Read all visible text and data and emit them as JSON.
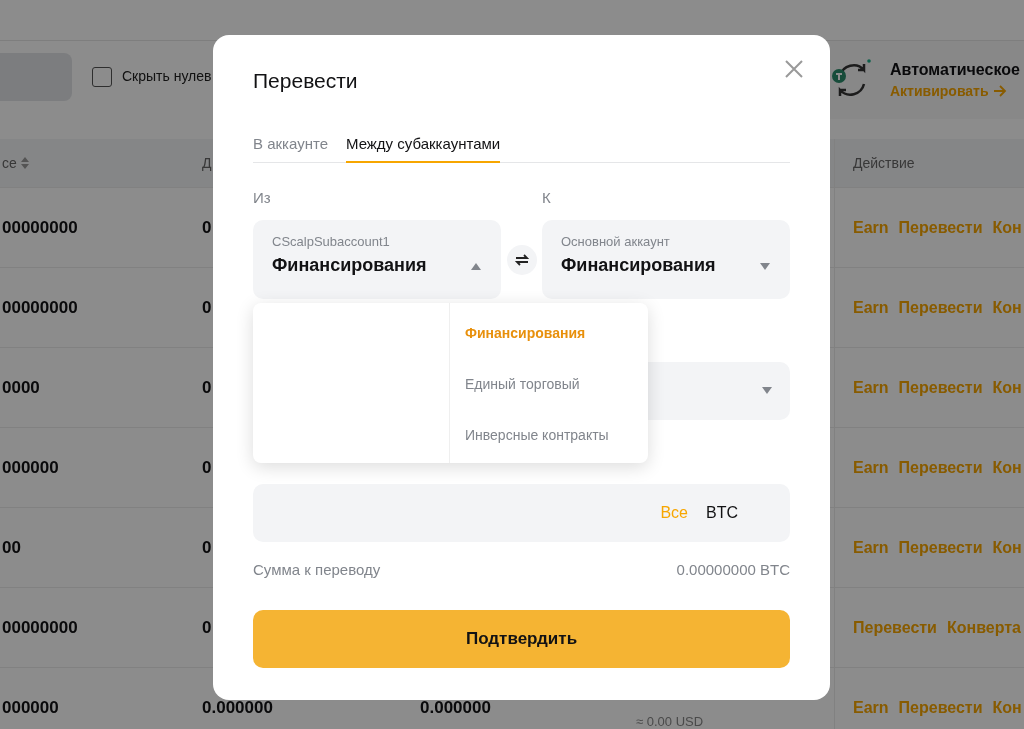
{
  "toolbar": {
    "hide_zero": {
      "label": "Скрыть нулев",
      "checked": false
    }
  },
  "banner": {
    "title": "Автоматическое",
    "link": "Активировать"
  },
  "table": {
    "header": {
      "column_1": "се",
      "column_2": "Д",
      "action": "Действие"
    },
    "rows": [
      {
        "column_1": "00000000",
        "column_2": "0",
        "actions": [
          "Earn",
          "Перевести",
          "Кон"
        ]
      },
      {
        "column_1": "00000000",
        "column_2": "0",
        "actions": [
          "Earn",
          "Перевести",
          "Кон"
        ]
      },
      {
        "column_1": "0000",
        "column_2": "0",
        "actions": [
          "Earn",
          "Перевести",
          "Кон"
        ]
      },
      {
        "column_1": "000000",
        "column_2": "0",
        "actions": [
          "Earn",
          "Перевести",
          "Кон"
        ]
      },
      {
        "column_1": "00",
        "column_2": "0",
        "actions": [
          "Earn",
          "Перевести",
          "Кон"
        ]
      },
      {
        "column_1": "00000000",
        "column_2": "0",
        "actions": [
          "Перевести",
          "Конверта"
        ]
      },
      {
        "column_1": "000000",
        "column_2": "0.000000",
        "column_3": "0.000000",
        "column_4": "≈ 0.00 USD",
        "actions": [
          "Earn",
          "Перевести",
          "Кон"
        ]
      }
    ]
  },
  "dialog": {
    "title": "Перевести",
    "tabs": [
      {
        "label": "В аккаунте",
        "selected": false
      },
      {
        "label": "Между субаккаунтами",
        "selected": true
      }
    ],
    "from": {
      "label": "Из",
      "account": "CScalpSubaccount1",
      "wallet": "Финансирования",
      "expanded": true
    },
    "to": {
      "label": "К",
      "account": "Основной аккаунт",
      "wallet": "Финансирования",
      "expanded": false
    },
    "wallet_options": [
      {
        "label": "Финансирования",
        "selected": true
      },
      {
        "label": "Единый торговый",
        "selected": false
      },
      {
        "label": "Инверсные контракты",
        "selected": false
      }
    ],
    "amount": {
      "max_link": "Все",
      "currency": "BTC"
    },
    "summary": {
      "label": "Сумма к переводу",
      "value": "0.00000000 BTC"
    },
    "confirm": "Подтвердить"
  }
}
